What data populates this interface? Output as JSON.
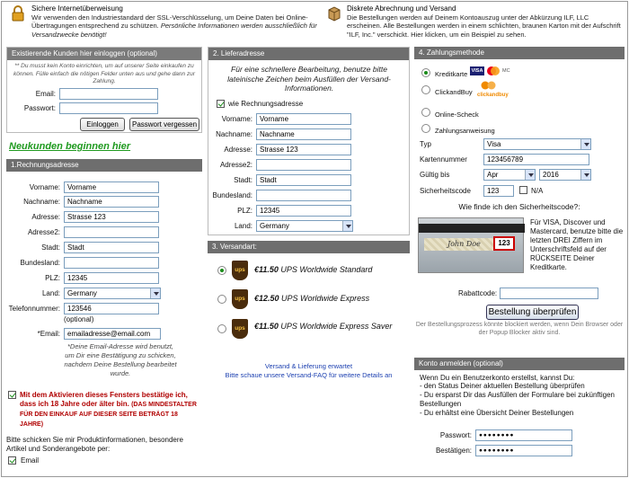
{
  "top": {
    "secure_title": "Sichere Internetüberweisung",
    "secure_text": "Wir verwenden den Industriestandard der SSL-Verschlüsselung, um Deine Daten bei Online-Übertragungen entsprechend zu schützen.",
    "secure_text_it": "Persönliche Informationen werden ausschließlich für Versandzwecke benötigt!",
    "billing_title": "Diskrete Abrechnung und Versand",
    "billing_text": "Die Bestellungen werden auf Deinem Kontoauszug unter der Abkürzung ILF, LLC erscheinen. Alle Bestellungen werden in einem schlichten, braunen Karton mit der Aufschrift \"ILF, Inc.\" verschickt. Hier klicken, um ein Beispiel zu sehen."
  },
  "login": {
    "header": "Existierende Kunden hier einloggen (optional)",
    "intro": "** Du musst kein Konto einrichten, um auf unserer Seite einkaufen zu können. Fülle einfach die nötigen Felder unten aus und gehe dann zur Zahlung.",
    "email_label": "Email:",
    "password_label": "Passwort:",
    "login_button": "Einloggen",
    "forgot_button": "Passwort vergessen"
  },
  "new_customers": "Neukunden beginnen hier",
  "billing": {
    "header": "1.Rechnungsadresse",
    "labels": {
      "firstname": "Vorname:",
      "lastname": "Nachname:",
      "address": "Adresse:",
      "address2": "Adresse2:",
      "city": "Stadt:",
      "state": "Bundesland:",
      "zip": "PLZ:",
      "country": "Land:",
      "phone": "Telefonnummer:",
      "phone_opt": "(optional)",
      "email": "*Email:"
    },
    "values": {
      "firstname": "Vorname",
      "lastname": "Nachname",
      "address": "Strasse 123",
      "address2": "",
      "city": "Stadt",
      "state": "",
      "zip": "12345",
      "country": "Germany",
      "phone": "123546",
      "email": "emailadresse@email.com"
    },
    "email_note": "*Deine Email-Adresse wird benutzt, um Dir eine Bestätigung zu schicken, nachdem Deine Bestellung bearbeitet wurde.",
    "age_text": "Mit dem Aktivieren dieses Fensters bestätige ich, dass ich 18 Jahre oder älter bin.",
    "age_caps": "(DAS MINDESTALTER FÜR DEN EINKAUF AUF DIESER SEITE BETRÄGT 18 JAHRE)",
    "newsletter_text": "Bitte schicken Sie mir Produktinformationen, besondere Artikel und Sonderangebote per:",
    "newsletter_email": "Email"
  },
  "shipping": {
    "header": "2. Lieferadresse",
    "intro": "Für eine schnellere Bearbeitung, benutze bitte lateinische Zeichen beim Ausfüllen der Versand- Informationen.",
    "same_as_billing": "wie Rechnungsadresse",
    "labels": {
      "firstname": "Vorname:",
      "lastname": "Nachname:",
      "address": "Adresse:",
      "address2": "Adresse2:",
      "city": "Stadt:",
      "state": "Bundesland:",
      "zip": "PLZ:",
      "country": "Land:"
    },
    "values": {
      "firstname": "Vorname",
      "lastname": "Nachname",
      "address": "Strasse 123",
      "address2": "",
      "city": "Stadt",
      "state": "",
      "zip": "12345",
      "country": "Germany"
    }
  },
  "shipmethod": {
    "header": "3. Versandart:",
    "options": [
      {
        "price": "€11.50",
        "name": "UPS Worldwide Standard",
        "selected": true
      },
      {
        "price": "€12.50",
        "name": "UPS Worldwide Express",
        "selected": false
      },
      {
        "price": "€11.50",
        "name": "UPS Worldwide Express Saver",
        "selected": false
      }
    ],
    "ups_logo": "ups",
    "delivery_link": "Versand & Lieferung erwartet",
    "faq_link": "Bitte schaue unsere Versand-FAQ für weitere Details an"
  },
  "payment": {
    "header": "4. Zahlungsmethode",
    "methods": [
      {
        "label": "Kreditkarte",
        "selected": true
      },
      {
        "label": "ClickandBuy",
        "selected": false
      },
      {
        "label": "Online-Scheck",
        "selected": false
      },
      {
        "label": "Zahlungsanweisung",
        "selected": false
      }
    ],
    "card_logos": [
      "VISA",
      "MC"
    ],
    "clickandbuy_logo": "clickandbuy",
    "type_label": "Typ",
    "type_value": "Visa",
    "cardnumber_label": "Kartennummer",
    "cardnumber_value": "123456789",
    "valid_label": "Gültig bis",
    "month_value": "Apr",
    "year_value": "2016",
    "cvv_label": "Sicherheitscode",
    "cvv_value": "123",
    "na_label": "N/A",
    "cvv_question": "Wie finde ich den Sicherheitscode?:",
    "cvv_help": "Für VISA, Discover und Mastercard, benutze bitte die letzten DREI Ziffern im Unterschriftsfeld auf der RÜCKSEITE Deiner Kreditkarte.",
    "card_sig": "John Doe",
    "card_code": "123",
    "discount_label": "Rabattcode:",
    "discount_value": "",
    "submit_button": "Bestellung überprüfen",
    "popup_note": "Der Bestellungsprozess könnte blockiert werden, wenn Dein Browser oder der Popup Blocker aktiv sind."
  },
  "account": {
    "header": "Konto anmelden (optional)",
    "intro": "Wenn Du ein Benutzerkonto erstellst, kannst Du:",
    "benefits": [
      "- den Status Deiner aktuellen Bestellung überprüfen",
      "- Du ersparst Dir das Ausfüllen der Formulare bei zukünftigen Bestellungen",
      "- Du erhältst eine Übersicht Deiner Bestellungen"
    ],
    "password_label": "Passwort:",
    "password_value": "●●●●●●●●",
    "confirm_label": "Bestätigen:",
    "confirm_value": "●●●●●●●●"
  }
}
